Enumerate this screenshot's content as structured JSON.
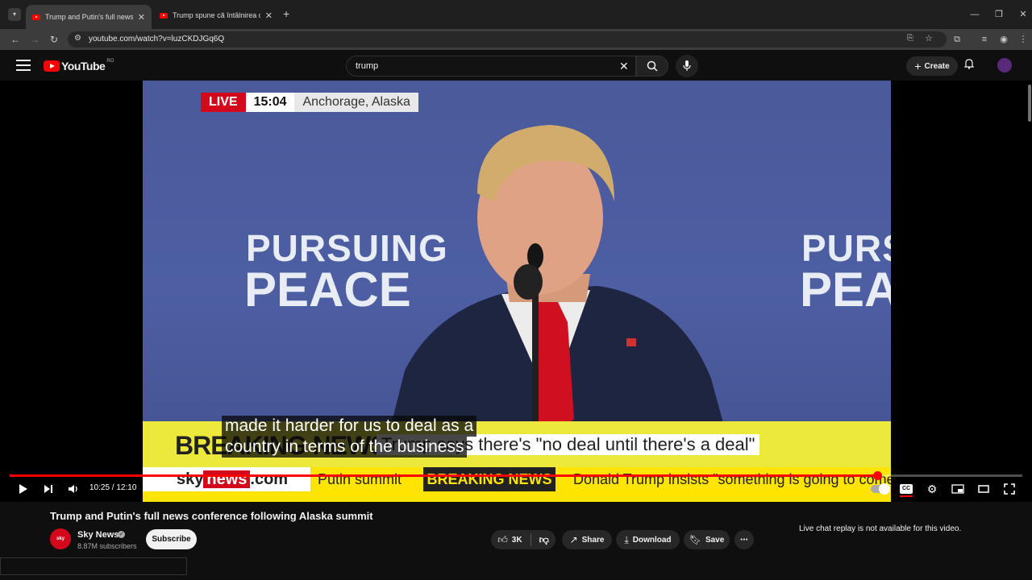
{
  "browser": {
    "tabs": [
      {
        "title": "Trump and Putin's full news co",
        "active": true
      },
      {
        "title": "Trump spune că întâlnirea cu P",
        "active": false
      }
    ],
    "new_tab": "+",
    "url": "youtube.com/watch?v=luzCKDJGq6Q"
  },
  "youtube": {
    "logo_text": "YouTube",
    "country_code": "RO",
    "search_value": "trump",
    "create_label": "Create"
  },
  "video": {
    "live_label": "LIVE",
    "time": "15:04",
    "location": "Anchorage, Alaska",
    "bg_text_line1": "PURSUING",
    "bg_text_line2": "PEACE",
    "breaking_banner": "BREAKING NEWS",
    "headline": "Trump says there's \"no deal until there's a deal\"",
    "ticker_site_sky": "sky",
    "ticker_site_news": "news",
    "ticker_site_com": ".com",
    "ticker_topic": "Putin summit",
    "ticker_breaking": "BREAKING NEWS",
    "ticker_text": "Donald Trump insists \"something is going to come",
    "caption_line1": "made it harder for us to deal as a",
    "caption_line2": "country in terms of the business",
    "time_current": "10:25",
    "time_total": "12:10",
    "progress_fraction": 0.857,
    "accent_color": "#ff0000"
  },
  "meta": {
    "title": "Trump and Putin's full news conference following Alaska summit",
    "channel": "Sky News",
    "channel_avatar_text": "sky news",
    "subscribers": "8.87M subscribers",
    "subscribe_label": "Subscribe",
    "likes": "3K",
    "share_label": "Share",
    "download_label": "Download",
    "save_label": "Save",
    "live_chat": "Live chat replay is not available for this video."
  }
}
